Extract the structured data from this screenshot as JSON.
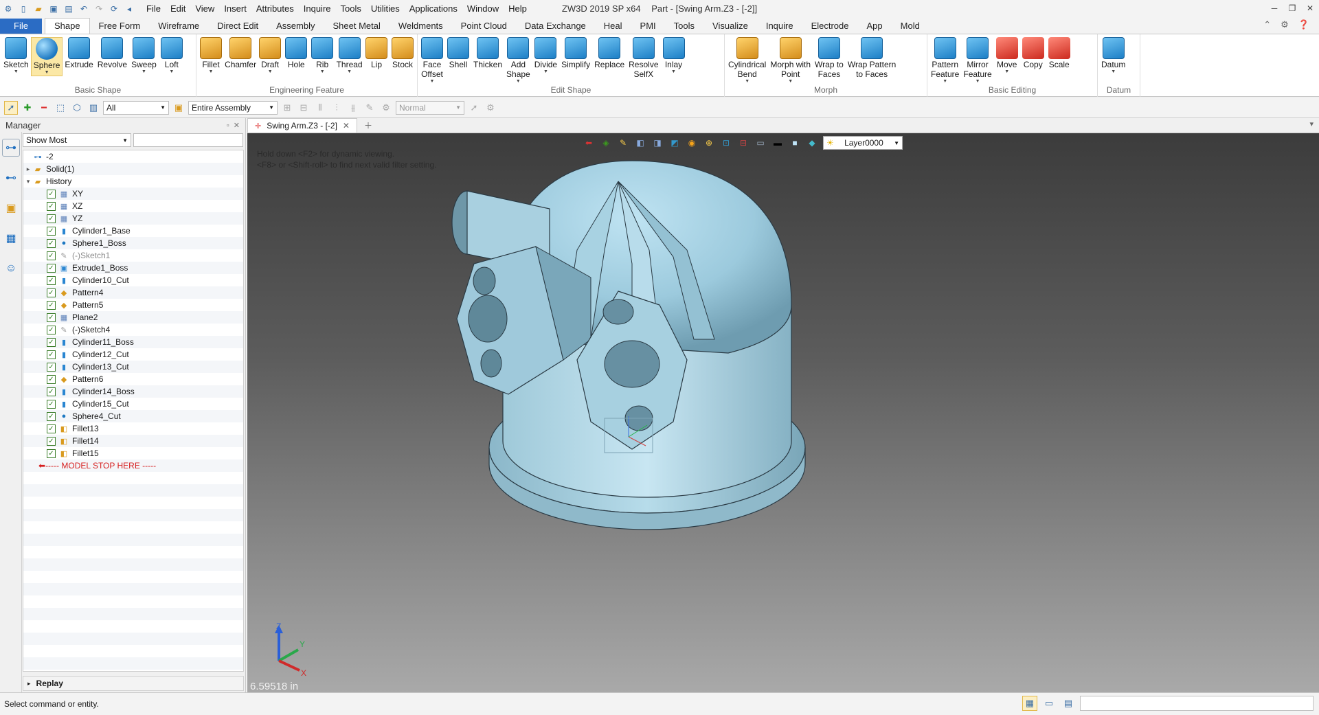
{
  "app": {
    "window_title": "ZW3D 2019 SP x64",
    "part_title": "Part - [Swing Arm.Z3 - [-2]]",
    "menu": [
      "File",
      "Edit",
      "View",
      "Insert",
      "Attributes",
      "Inquire",
      "Tools",
      "Utilities",
      "Applications",
      "Window",
      "Help"
    ],
    "window_controls": [
      "─",
      "❐",
      "✕"
    ]
  },
  "ribbon_tabs": [
    "File",
    "Shape",
    "Free Form",
    "Wireframe",
    "Direct Edit",
    "Assembly",
    "Sheet Metal",
    "Weldments",
    "Point Cloud",
    "Data Exchange",
    "Heal",
    "PMI",
    "Tools",
    "Visualize",
    "Inquire",
    "Electrode",
    "App",
    "Mold"
  ],
  "ribbon_active_tab": "Shape",
  "ribbon_right_icons": [
    "caret-up-icon",
    "gear-icon",
    "help-icon"
  ],
  "ribbon_groups": [
    {
      "label": "Basic Shape",
      "buttons": [
        {
          "label": "Sketch",
          "icon": "sketch-icon",
          "dd": true
        },
        {
          "label": "Sphere",
          "icon": "sphere-icon",
          "dd": true,
          "selected": true
        },
        {
          "label": "Extrude",
          "icon": "extrude-icon"
        },
        {
          "label": "Revolve",
          "icon": "revolve-icon"
        },
        {
          "label": "Sweep",
          "icon": "sweep-icon",
          "dd": true
        },
        {
          "label": "Loft",
          "icon": "loft-icon",
          "dd": true
        }
      ]
    },
    {
      "label": "Engineering Feature",
      "buttons": [
        {
          "label": "Fillet",
          "icon": "fillet-icon",
          "dd": true
        },
        {
          "label": "Chamfer",
          "icon": "chamfer-icon"
        },
        {
          "label": "Draft",
          "icon": "draft-icon",
          "dd": true
        },
        {
          "label": "Hole",
          "icon": "hole-icon"
        },
        {
          "label": "Rib",
          "icon": "rib-icon",
          "dd": true
        },
        {
          "label": "Thread",
          "icon": "thread-icon",
          "dd": true
        },
        {
          "label": "Lip",
          "icon": "lip-icon"
        },
        {
          "label": "Stock",
          "icon": "stock-icon"
        }
      ]
    },
    {
      "label": "Edit Shape",
      "buttons": [
        {
          "label": "Face\nOffset",
          "icon": "face-offset-icon",
          "dd": true
        },
        {
          "label": "Shell",
          "icon": "shell-icon"
        },
        {
          "label": "Thicken",
          "icon": "thicken-icon"
        },
        {
          "label": "Add\nShape",
          "icon": "add-shape-icon",
          "dd": true
        },
        {
          "label": "Divide",
          "icon": "divide-icon",
          "dd": true
        },
        {
          "label": "Simplify",
          "icon": "simplify-icon"
        },
        {
          "label": "Replace",
          "icon": "replace-icon"
        },
        {
          "label": "Resolve\nSelfX",
          "icon": "resolve-selfx-icon"
        },
        {
          "label": "Inlay",
          "icon": "inlay-icon",
          "dd": true
        }
      ]
    },
    {
      "label": "Morph",
      "buttons": [
        {
          "label": "Cylindrical\nBend",
          "icon": "cylindrical-bend-icon",
          "dd": true
        },
        {
          "label": "Morph with\nPoint",
          "icon": "morph-point-icon",
          "dd": true
        },
        {
          "label": "Wrap to\nFaces",
          "icon": "wrap-faces-icon"
        },
        {
          "label": "Wrap Pattern\nto Faces",
          "icon": "wrap-pattern-icon"
        }
      ]
    },
    {
      "label": "Basic Editing",
      "buttons": [
        {
          "label": "Pattern\nFeature",
          "icon": "pattern-feature-icon",
          "dd": true
        },
        {
          "label": "Mirror\nFeature",
          "icon": "mirror-feature-icon",
          "dd": true
        },
        {
          "label": "Move",
          "icon": "move-icon",
          "dd": true
        },
        {
          "label": "Copy",
          "icon": "copy-icon"
        },
        {
          "label": "Scale",
          "icon": "scale-icon"
        }
      ]
    },
    {
      "label": "Datum",
      "buttons": [
        {
          "label": "Datum",
          "icon": "datum-icon",
          "dd": true
        }
      ]
    }
  ],
  "toolbar": {
    "filter_value": "All",
    "assembly_value": "Entire Assembly",
    "mode_value": "Normal"
  },
  "manager": {
    "title": "Manager",
    "filter_value": "Show Most",
    "search_value": "",
    "root_label": "-2",
    "items": [
      {
        "label": "Solid(1)",
        "level": 1,
        "expander": "▸",
        "icon": "folder-icon"
      },
      {
        "label": "History",
        "level": 1,
        "expander": "▾",
        "icon": "folder-icon"
      },
      {
        "label": "XY",
        "level": 2,
        "checked": true,
        "icon": "plane-icon"
      },
      {
        "label": "XZ",
        "level": 2,
        "checked": true,
        "icon": "plane-icon"
      },
      {
        "label": "YZ",
        "level": 2,
        "checked": true,
        "icon": "plane-icon"
      },
      {
        "label": "Cylinder1_Base",
        "level": 2,
        "checked": true,
        "icon": "cylinder-icon"
      },
      {
        "label": "Sphere1_Boss",
        "level": 2,
        "checked": true,
        "icon": "sphere-icon"
      },
      {
        "label": "(-)Sketch1",
        "level": 2,
        "checked": true,
        "icon": "sketch-icon",
        "dim": true
      },
      {
        "label": "Extrude1_Boss",
        "level": 2,
        "checked": true,
        "icon": "extrude-icon"
      },
      {
        "label": "Cylinder10_Cut",
        "level": 2,
        "checked": true,
        "icon": "cylinder-icon"
      },
      {
        "label": "Pattern4",
        "level": 2,
        "checked": true,
        "icon": "pattern-icon"
      },
      {
        "label": "Pattern5",
        "level": 2,
        "checked": true,
        "icon": "pattern-icon"
      },
      {
        "label": "Plane2",
        "level": 2,
        "checked": true,
        "icon": "plane-icon"
      },
      {
        "label": "(-)Sketch4",
        "level": 2,
        "checked": true,
        "icon": "sketch-icon"
      },
      {
        "label": "Cylinder11_Boss",
        "level": 2,
        "checked": true,
        "icon": "cylinder-icon"
      },
      {
        "label": "Cylinder12_Cut",
        "level": 2,
        "checked": true,
        "icon": "cylinder-icon"
      },
      {
        "label": "Cylinder13_Cut",
        "level": 2,
        "checked": true,
        "icon": "cylinder-icon"
      },
      {
        "label": "Pattern6",
        "level": 2,
        "checked": true,
        "icon": "pattern-icon"
      },
      {
        "label": "Cylinder14_Boss",
        "level": 2,
        "checked": true,
        "icon": "cylinder-icon"
      },
      {
        "label": "Cylinder15_Cut",
        "level": 2,
        "checked": true,
        "icon": "cylinder-icon"
      },
      {
        "label": "Sphere4_Cut",
        "level": 2,
        "checked": true,
        "icon": "sphere-icon"
      },
      {
        "label": "Fillet13",
        "level": 2,
        "checked": true,
        "icon": "fillet-icon"
      },
      {
        "label": "Fillet14",
        "level": 2,
        "checked": true,
        "icon": "fillet-icon"
      },
      {
        "label": "Fillet15",
        "level": 2,
        "checked": true,
        "icon": "fillet-icon"
      }
    ],
    "stop_label": "----- MODEL STOP HERE -----",
    "replay_label": "Replay"
  },
  "doc_tab": {
    "label": "Swing Arm.Z3 - [-2]"
  },
  "viewport": {
    "hint_line1": "Hold down <F2> for dynamic viewing.",
    "hint_line2": "<F8> or <Shift-roll> to find next valid filter setting.",
    "layer": "Layer0000",
    "scale_text": "6.59518 in",
    "axis_labels": {
      "z": "Z",
      "y": "Y",
      "x": "X"
    }
  },
  "status": {
    "message": "Select command or entity."
  },
  "colors": {
    "accent": "#2b6cc4",
    "model": "#a9cfe0",
    "stop": "#d61f1f"
  }
}
